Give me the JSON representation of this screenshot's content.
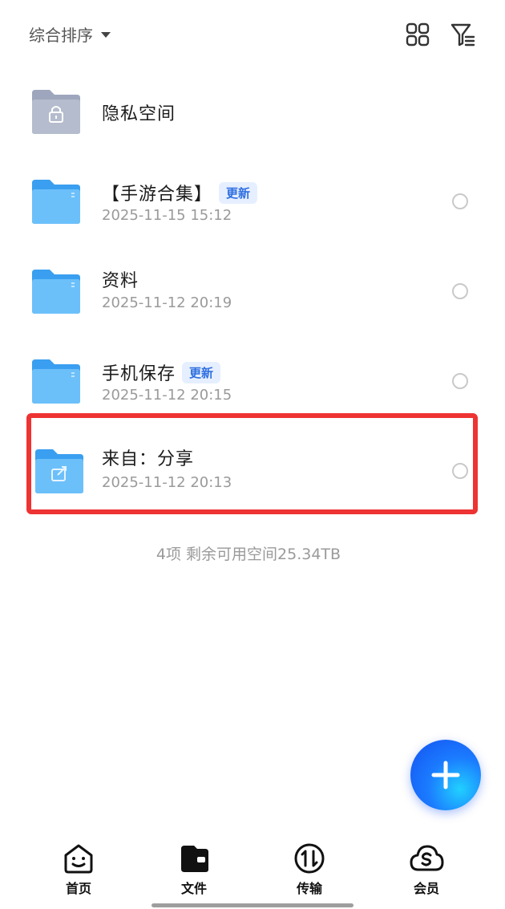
{
  "toolbar": {
    "sort_label": "综合排序",
    "grid_icon": "grid-view-icon",
    "filter_icon": "filter-icon"
  },
  "files": [
    {
      "name": "隐私空间",
      "type": "private",
      "icon": "lock-folder-icon"
    },
    {
      "name": "【手游合集】",
      "badge": "更新",
      "date": "2025-11-15 15:12",
      "icon": "folder-icon"
    },
    {
      "name": "资料",
      "date": "2025-11-12 20:19",
      "icon": "folder-icon"
    },
    {
      "name": "手机保存",
      "badge": "更新",
      "date": "2025-11-12 20:15",
      "icon": "folder-icon"
    },
    {
      "name": "来自：分享",
      "date": "2025-11-12 20:13",
      "icon": "shared-folder-icon",
      "highlighted": true
    }
  ],
  "summary": "4项 剩余可用空间25.34TB",
  "nav": [
    {
      "label": "首页",
      "icon": "home-face-icon"
    },
    {
      "label": "文件",
      "icon": "wallet-file-icon",
      "active": true
    },
    {
      "label": "传输",
      "icon": "transfer-icon"
    },
    {
      "label": "会员",
      "icon": "cloud-member-icon"
    }
  ],
  "colors": {
    "accent": "#1b7cff",
    "badge_text": "#2f6fe0",
    "badge_bg": "#e6efff",
    "highlight": "#ee3333",
    "folder": "#5fb4f6",
    "private_folder": "#aab2c6"
  }
}
